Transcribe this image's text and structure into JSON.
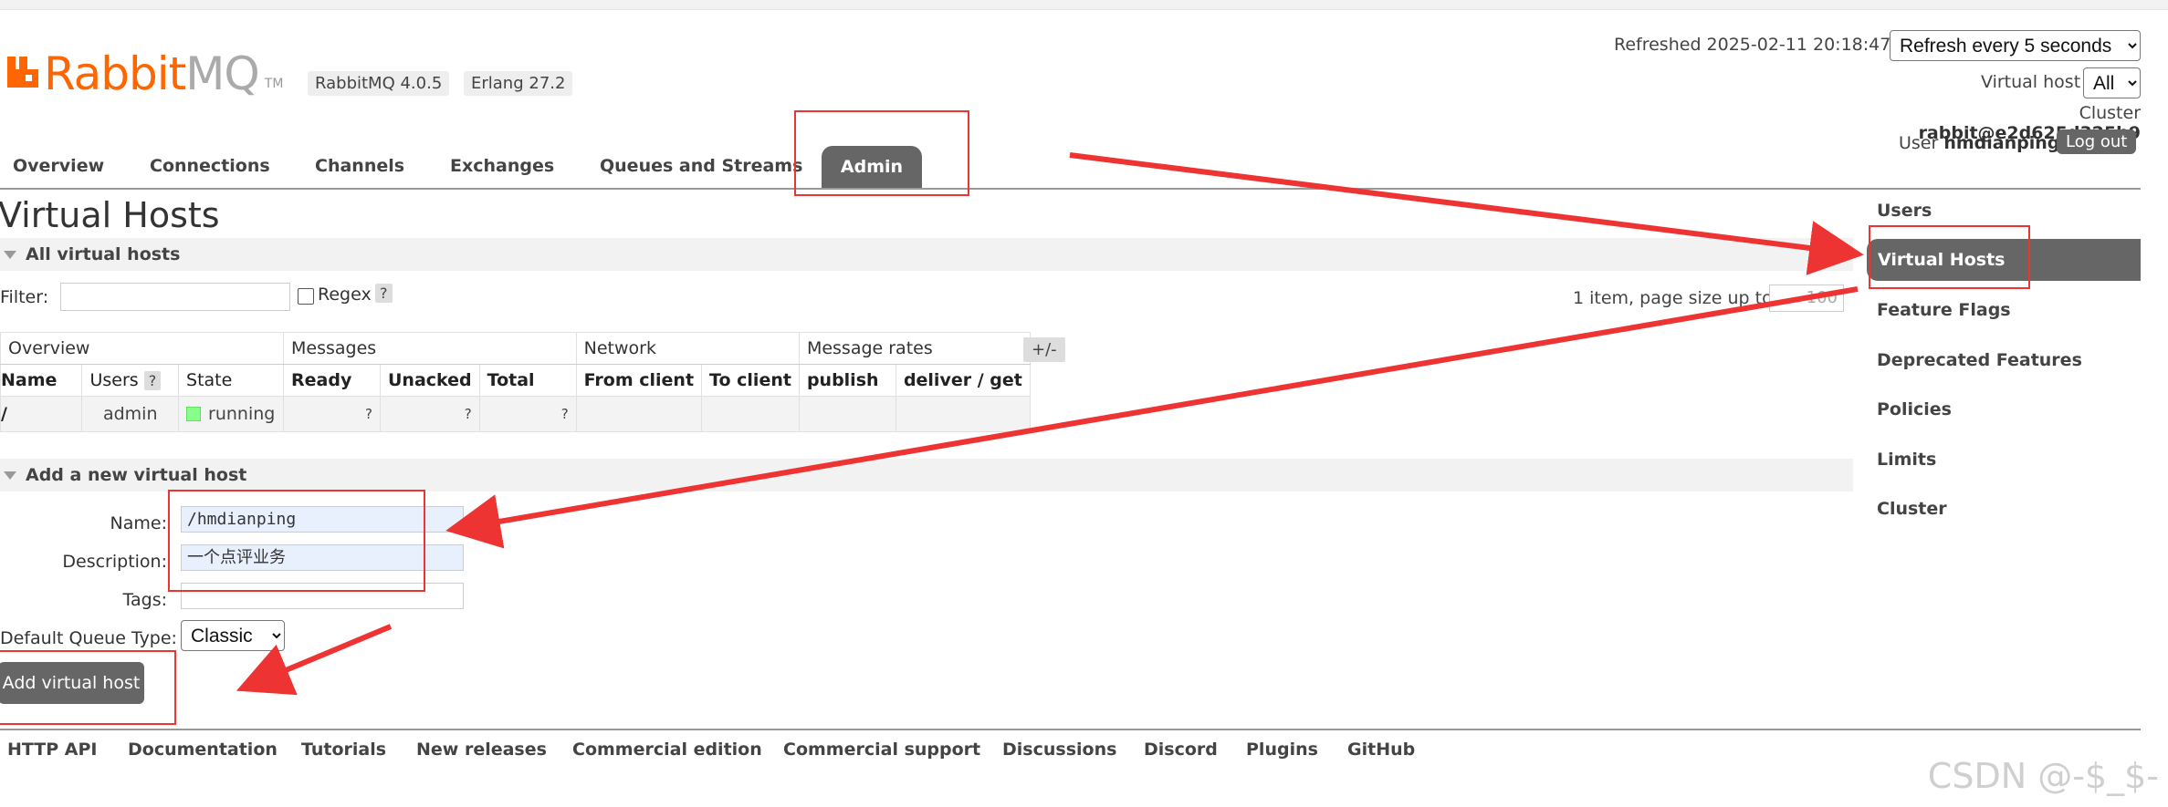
{
  "header": {
    "logo_text_rabbit": "Rabbit",
    "logo_text_mq": "MQ",
    "logo_tm": "TM",
    "version_badge": "RabbitMQ 4.0.5",
    "erlang_badge": "Erlang 27.2",
    "refreshed_text": "Refreshed 2025-02-11 20:18:47",
    "refresh_select": "Refresh every 5 seconds",
    "vhost_label": "Virtual host",
    "vhost_select": "All",
    "cluster_label": "Cluster",
    "cluster_value": "rabbit@e2d625d325b9",
    "user_label": "User",
    "user_value": "hmdianping",
    "logout_label": "Log out"
  },
  "nav": {
    "overview": "Overview",
    "connections": "Connections",
    "channels": "Channels",
    "exchanges": "Exchanges",
    "queues": "Queues and Streams",
    "admin": "Admin"
  },
  "page": {
    "title": "Virtual Hosts",
    "all_section": "All virtual hosts",
    "filter_label": "Filter:",
    "regex_label": "Regex",
    "help": "?",
    "pager_text": "1 item, page size up to",
    "page_size": "100",
    "plusminus": "+/-"
  },
  "table": {
    "groups": [
      "Overview",
      "Messages",
      "Network",
      "Message rates"
    ],
    "columns": [
      "Name",
      "Users",
      "State",
      "Ready",
      "Unacked",
      "Total",
      "From client",
      "To client",
      "publish",
      "deliver / get"
    ],
    "users_help": "?",
    "rows": [
      {
        "name": "/",
        "users": "admin",
        "state": "running",
        "ready": "?",
        "unacked": "?",
        "total": "?"
      }
    ]
  },
  "form": {
    "section": "Add a new virtual host",
    "name_label": "Name:",
    "name_value": "/hmdianping",
    "required_mark": "*",
    "description_label": "Description:",
    "description_value": "一个点评业务",
    "tags_label": "Tags:",
    "tags_value": "",
    "queue_type_label": "Default Queue Type:",
    "queue_type_value": "Classic",
    "submit_label": "Add virtual host"
  },
  "sidebar": {
    "items": [
      "Users",
      "Virtual Hosts",
      "Feature Flags",
      "Deprecated Features",
      "Policies",
      "Limits",
      "Cluster"
    ],
    "active": "Virtual Hosts"
  },
  "footer": {
    "links": [
      "HTTP API",
      "Documentation",
      "Tutorials",
      "New releases",
      "Commercial edition",
      "Commercial support",
      "Discussions",
      "Discord",
      "Plugins",
      "GitHub"
    ]
  },
  "watermark": "CSDN @-$_$-",
  "colors": {
    "brand_orange": "#ff6600",
    "nav_active_bg": "#666666",
    "annotation_red": "#e33333",
    "running_green": "#88ff88"
  }
}
